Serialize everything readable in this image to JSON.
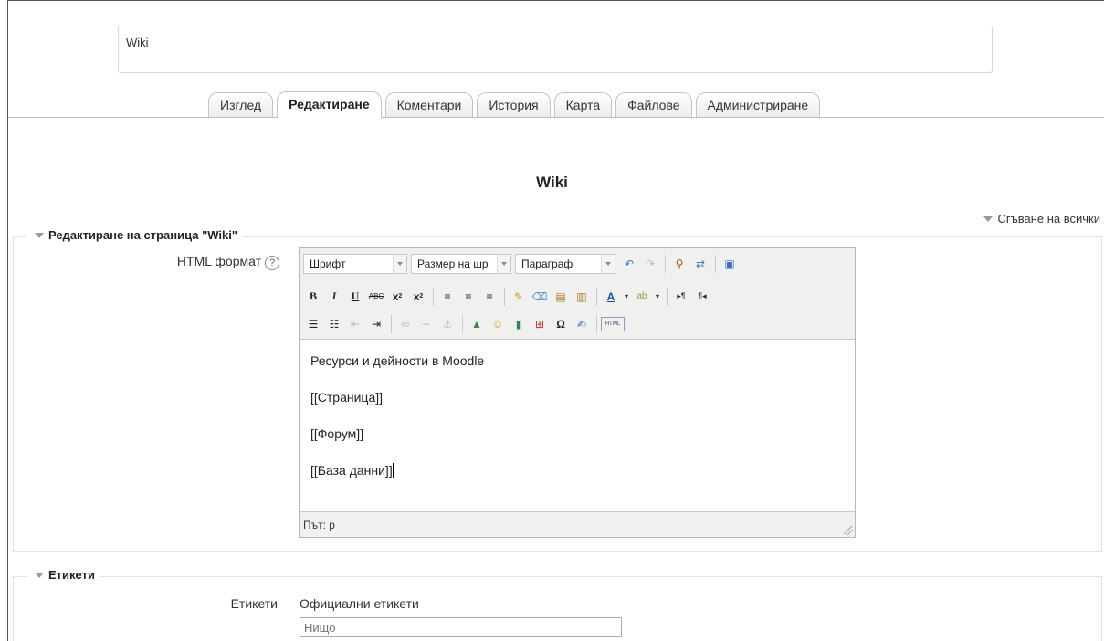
{
  "intro": {
    "text": "Wiki"
  },
  "tabs": [
    {
      "label": "Изглед",
      "active": false
    },
    {
      "label": "Редактиране",
      "active": true
    },
    {
      "label": "Коментари",
      "active": false
    },
    {
      "label": "История",
      "active": false
    },
    {
      "label": "Карта",
      "active": false
    },
    {
      "label": "Файлове",
      "active": false
    },
    {
      "label": "Администриране",
      "active": false
    }
  ],
  "page_title": "Wiki",
  "collapse_all": "Сгъване на всички",
  "edit_section": {
    "legend": "Редактиране на страница \"Wiki\"",
    "field_label": "HTML формат",
    "help_icon": "help-icon",
    "editor": {
      "font_dropdown": "Шрифт",
      "size_dropdown": "Размер на шр",
      "format_dropdown": "Параграф",
      "content_lines": [
        "Ресурси и дейности в Moodle",
        "[[Страница]]",
        "[[Форум]]",
        "[[База данни]]"
      ],
      "path": "Път: p"
    }
  },
  "tags_section": {
    "legend": "Етикети",
    "field_label": "Етикети",
    "official_tags_label": "Официални етикети",
    "input_placeholder": "Нищо"
  }
}
